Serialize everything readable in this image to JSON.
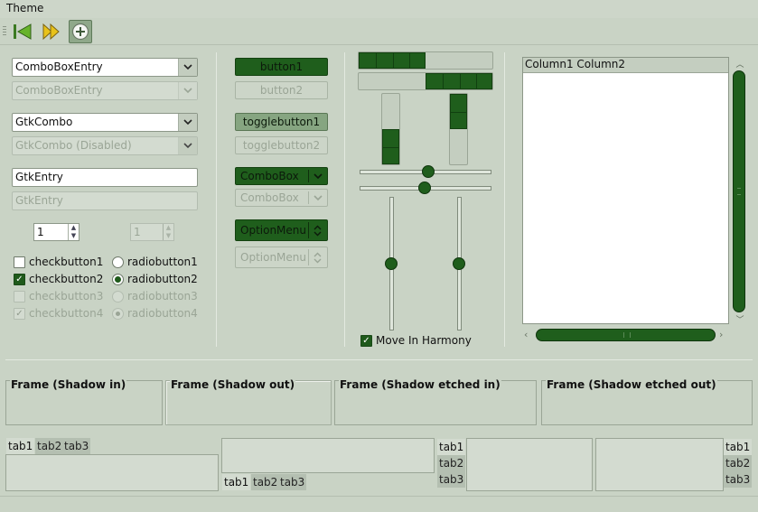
{
  "window": {
    "menu_label": "Theme"
  },
  "toolbar": {
    "back_icon": "back-arrow-icon",
    "forward_icon": "forward-arrow-icon",
    "add_icon": "add-icon"
  },
  "col1": {
    "combo_entry": "ComboBoxEntry",
    "combo_entry_dis": "ComboBoxEntry",
    "gtk_combo": "GtkCombo",
    "gtk_combo_dis": "GtkCombo (Disabled)",
    "gtk_entry": "GtkEntry",
    "gtk_entry_dis": "GtkEntry",
    "spin_value": "1",
    "spin_dis_value": "1",
    "checks": [
      "checkbutton1",
      "checkbutton2",
      "checkbutton3",
      "checkbutton4"
    ],
    "radios": [
      "radiobutton1",
      "radiobutton2",
      "radiobutton3",
      "radiobutton4"
    ]
  },
  "col2": {
    "button1": "button1",
    "button2": "button2",
    "toggle1": "togglebutton1",
    "toggle2": "togglebutton2",
    "combobox": "ComboBox",
    "combobox_dis": "ComboBox",
    "optionmenu": "OptionMenu",
    "optionmenu_dis": "OptionMenu"
  },
  "col3": {
    "harmony_label": "Move In Harmony",
    "progress": {
      "h1": 0.5,
      "h2": 0.5,
      "v1": 0.5,
      "v2": 0.5
    },
    "scales": {
      "h1": 0.5,
      "h2": 0.5,
      "v1": 0.5,
      "v2": 0.5
    }
  },
  "tree": {
    "columns": [
      "Column1",
      "Column2"
    ]
  },
  "frames": [
    "Frame (Shadow in)",
    "Frame (Shadow out)",
    "Frame (Shadow etched in)",
    "Frame (Shadow etched out)"
  ],
  "notebooks": {
    "tabs": [
      "tab1",
      "tab2",
      "tab3"
    ]
  },
  "colors": {
    "accent": "#1f5e1c",
    "background": "#c9d3c5"
  }
}
